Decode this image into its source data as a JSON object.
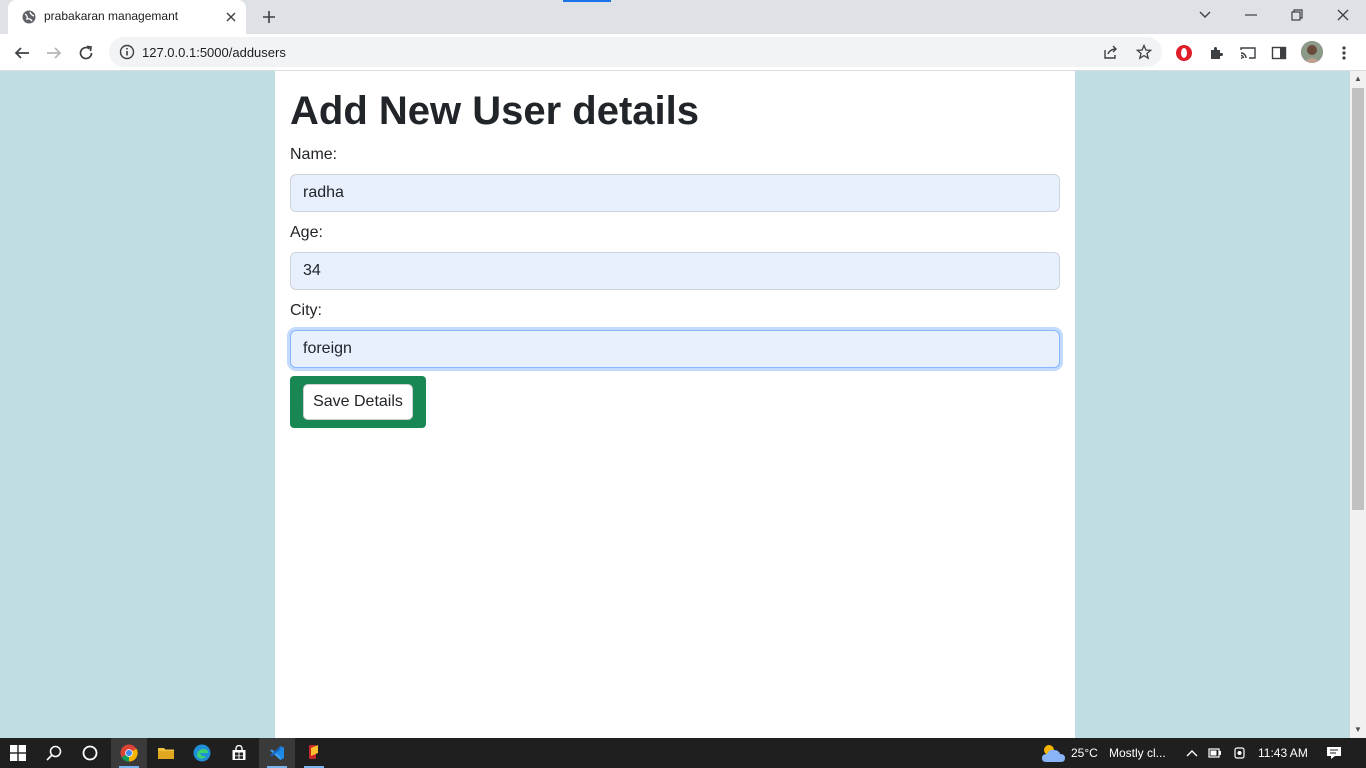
{
  "browser": {
    "tab_title": "prabakaran managemant",
    "url": "127.0.0.1:5000/addusers"
  },
  "page": {
    "title": "Add New User details",
    "name_label": "Name:",
    "name_value": "radha",
    "age_label": "Age:",
    "age_value": "34",
    "city_label": "City:",
    "city_value": "foreign",
    "save_label": "Save Details"
  },
  "taskbar": {
    "weather_temp": "25°C",
    "weather_text": "Mostly cl...",
    "time": "11:43 AM"
  },
  "colors": {
    "page_background": "#bfdde3",
    "input_fill": "#e8f0fe",
    "button_wrapper": "#198754",
    "focus_ring": "#86b7fe"
  },
  "icons": [
    "globe-icon",
    "close-icon",
    "plus-icon",
    "back-arrow-icon",
    "forward-arrow-icon",
    "reload-icon",
    "info-icon",
    "share-icon",
    "star-icon",
    "opera-icon",
    "extensions-icon",
    "cast-icon",
    "side-panel-icon",
    "menu-icon",
    "windows-start-icon",
    "search-icon",
    "cortana-icon",
    "chrome-icon",
    "file-explorer-icon",
    "edge-icon",
    "store-icon",
    "vscode-icon",
    "weather-icon",
    "notification-icon"
  ]
}
